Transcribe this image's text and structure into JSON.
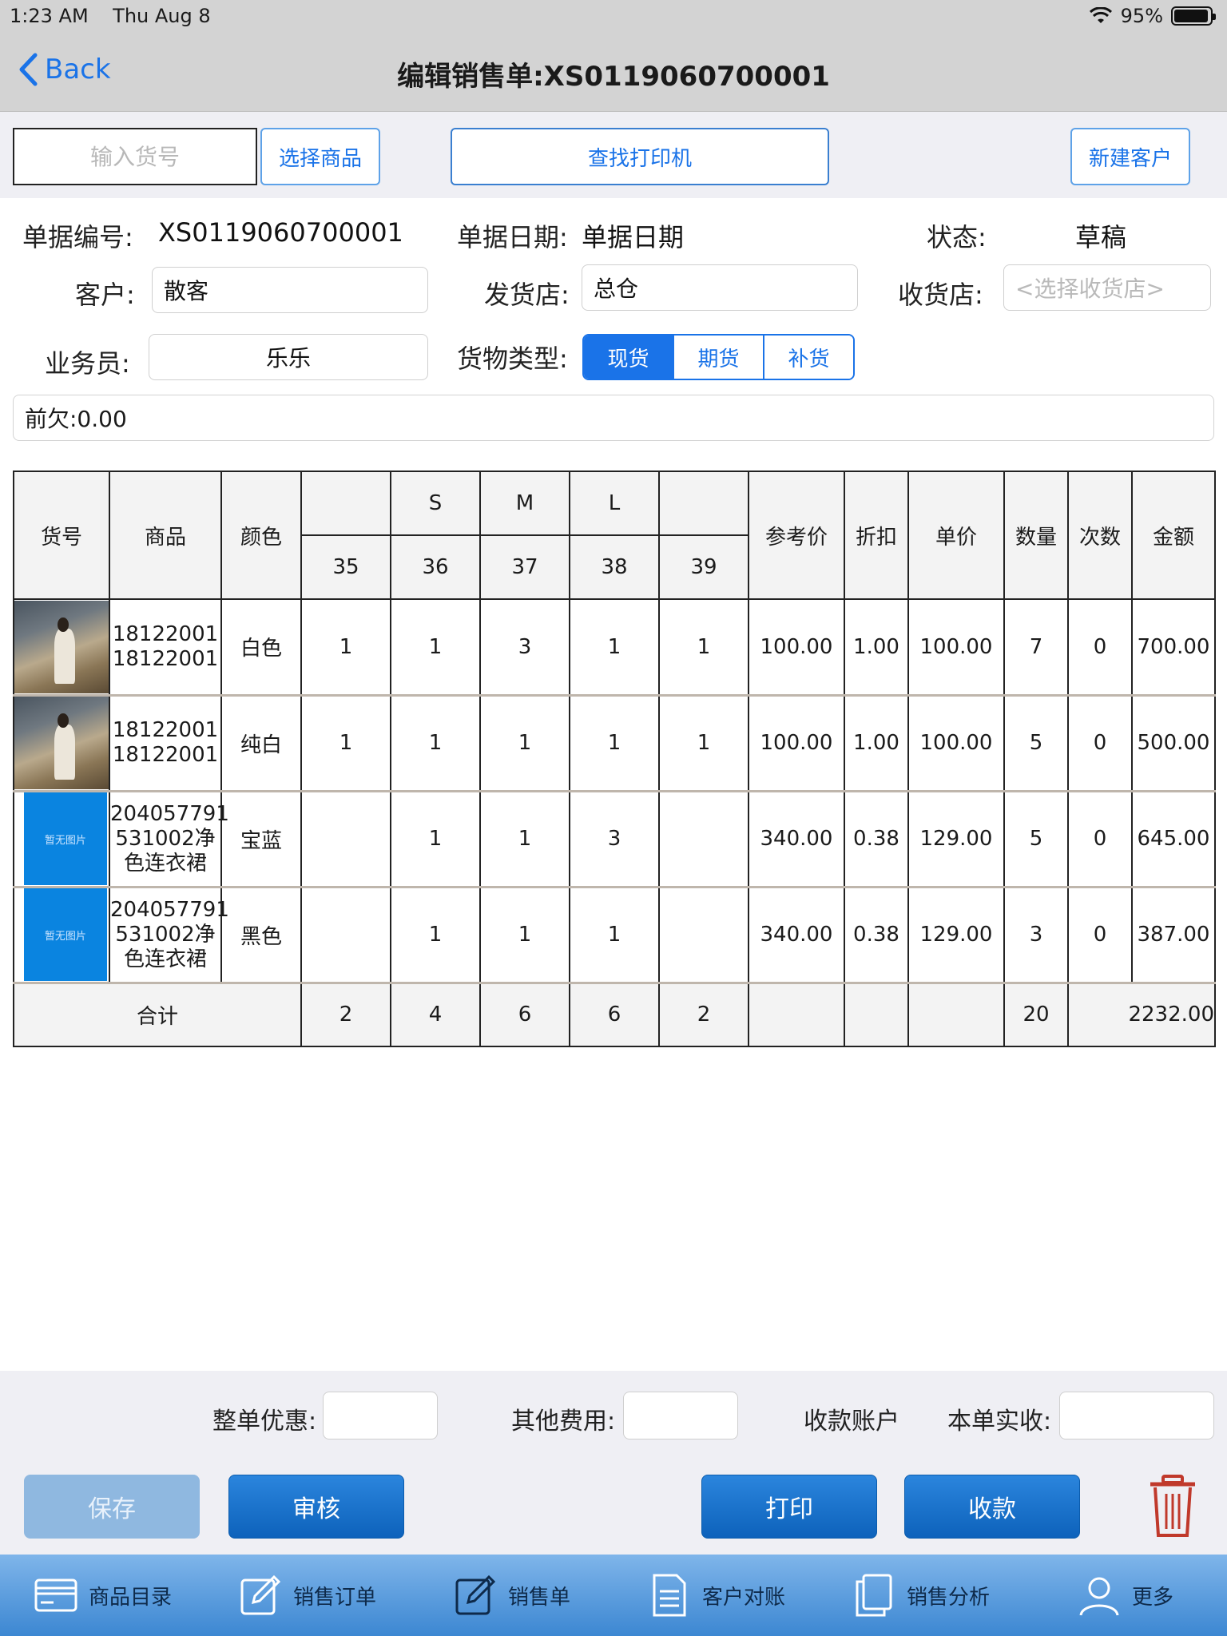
{
  "status": {
    "time": "1:23 AM",
    "date": "Thu Aug 8",
    "battery": "95%",
    "battery_level": 0.95
  },
  "nav": {
    "back": "Back",
    "title": "编辑销售单:XS0119060700001"
  },
  "actions": {
    "code_placeholder": "输入货号",
    "select_goods": "选择商品",
    "find_printer": "查找打印机",
    "new_customer": "新建客户"
  },
  "header": {
    "bill_no_label": "单据编号:",
    "bill_no": "XS0119060700001",
    "bill_date_label": "单据日期:",
    "bill_date": "单据日期",
    "status_label": "状态:",
    "status": "草稿",
    "customer_label": "客户:",
    "customer": "散客",
    "ship_store_label": "发货店:",
    "ship_store": "总仓",
    "recv_store_label": "收货店:",
    "recv_store_placeholder": "<选择收货店>",
    "salesman_label": "业务员:",
    "salesman": "乐乐",
    "goods_type_label": "货物类型:",
    "goods_types": [
      "现货",
      "期货",
      "补货"
    ],
    "prev_debt": "前欠:0.00"
  },
  "table": {
    "headers": {
      "code": "货号",
      "product": "商品",
      "color": "颜色",
      "size_groups": [
        "",
        "S",
        "M",
        "L",
        ""
      ],
      "sizes": [
        "35",
        "36",
        "37",
        "38",
        "39"
      ],
      "ref_price": "参考价",
      "discount": "折扣",
      "unit_price": "单价",
      "qty": "数量",
      "times": "次数",
      "amount": "金额"
    },
    "rows": [
      {
        "image": "photo",
        "product": "18122001\n18122001",
        "color": "白色",
        "sizes": [
          "1",
          "1",
          "3",
          "1",
          "1"
        ],
        "ref_price": "100.00",
        "discount": "1.00",
        "unit_price": "100.00",
        "qty": "7",
        "times": "0",
        "amount": "700.00"
      },
      {
        "image": "photo",
        "product": "18122001\n18122001",
        "color": "纯白",
        "sizes": [
          "1",
          "1",
          "1",
          "1",
          "1"
        ],
        "ref_price": "100.00",
        "discount": "1.00",
        "unit_price": "100.00",
        "qty": "5",
        "times": "0",
        "amount": "500.00"
      },
      {
        "image": "placeholder",
        "image_text": "暂无图片",
        "product": "204057791\n531002净\n色连衣裙",
        "color": "宝蓝",
        "sizes": [
          "",
          "1",
          "1",
          "3",
          ""
        ],
        "ref_price": "340.00",
        "discount": "0.38",
        "unit_price": "129.00",
        "qty": "5",
        "times": "0",
        "amount": "645.00"
      },
      {
        "image": "placeholder",
        "image_text": "暂无图片",
        "product": "204057791\n531002净\n色连衣裙",
        "color": "黑色",
        "sizes": [
          "",
          "1",
          "1",
          "1",
          ""
        ],
        "ref_price": "340.00",
        "discount": "0.38",
        "unit_price": "129.00",
        "qty": "3",
        "times": "0",
        "amount": "387.00"
      }
    ],
    "total": {
      "label": "合计",
      "sizes": [
        "2",
        "4",
        "6",
        "6",
        "2"
      ],
      "qty": "20",
      "amount": "2232.00"
    }
  },
  "footer": {
    "whole_discount_label": "整单优惠:",
    "other_fee_label": "其他费用:",
    "account_label": "收款账户",
    "actual_recv_label": "本单实收:",
    "save": "保存",
    "audit": "审核",
    "print": "打印",
    "collect": "收款"
  },
  "tabs": [
    {
      "label": "商品目录",
      "icon": "card-icon"
    },
    {
      "label": "销售订单",
      "icon": "edit-icon"
    },
    {
      "label": "销售单",
      "icon": "edit-icon"
    },
    {
      "label": "客户对账",
      "icon": "document-icon"
    },
    {
      "label": "销售分析",
      "icon": "copy-icon"
    },
    {
      "label": "更多",
      "icon": "person-icon"
    }
  ],
  "colors": {
    "accent": "#1a73e8",
    "tabbar": "#4a90d9",
    "trash": "#c0392b"
  }
}
